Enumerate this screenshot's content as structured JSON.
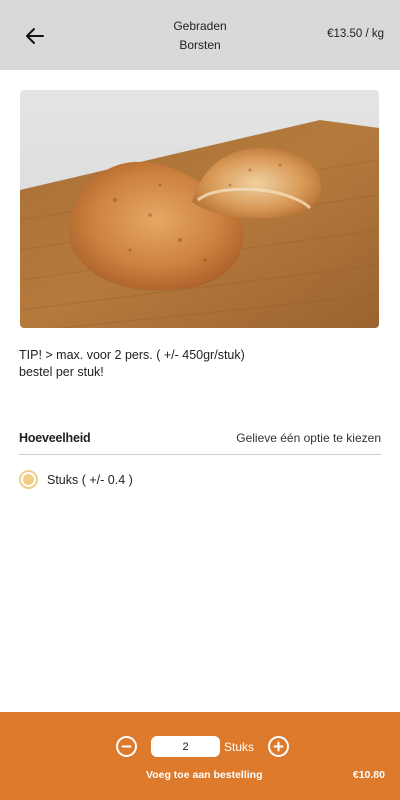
{
  "header": {
    "back_icon": "arrow-left-icon",
    "title_line1": "Gebraden",
    "title_line2": "Borsten",
    "price": "€13.50 / kg"
  },
  "product": {
    "image_subject": "roasted chicken breasts on wooden cutting board"
  },
  "tip": {
    "line1": "TIP! > max. voor 2 pers. ( +/- 450gr/stuk)",
    "line2": "bestel per stuk!"
  },
  "quantity": {
    "title": "Hoeveelheid",
    "hint": "Gelieve één optie te kiezen",
    "options": [
      {
        "label": "Stuks ( +/- 0.4 )",
        "selected": true
      }
    ]
  },
  "footer": {
    "qty_value": "2",
    "unit": "Stuks",
    "minus_icon": "minus-circle-icon",
    "plus_icon": "plus-circle-icon",
    "add_label": "Voeg toe aan bestelling",
    "total": "€10.80"
  },
  "colors": {
    "header_bg": "#d9d9d9",
    "footer_bg": "#de7a2c",
    "radio_accent": "#f2cd86"
  }
}
